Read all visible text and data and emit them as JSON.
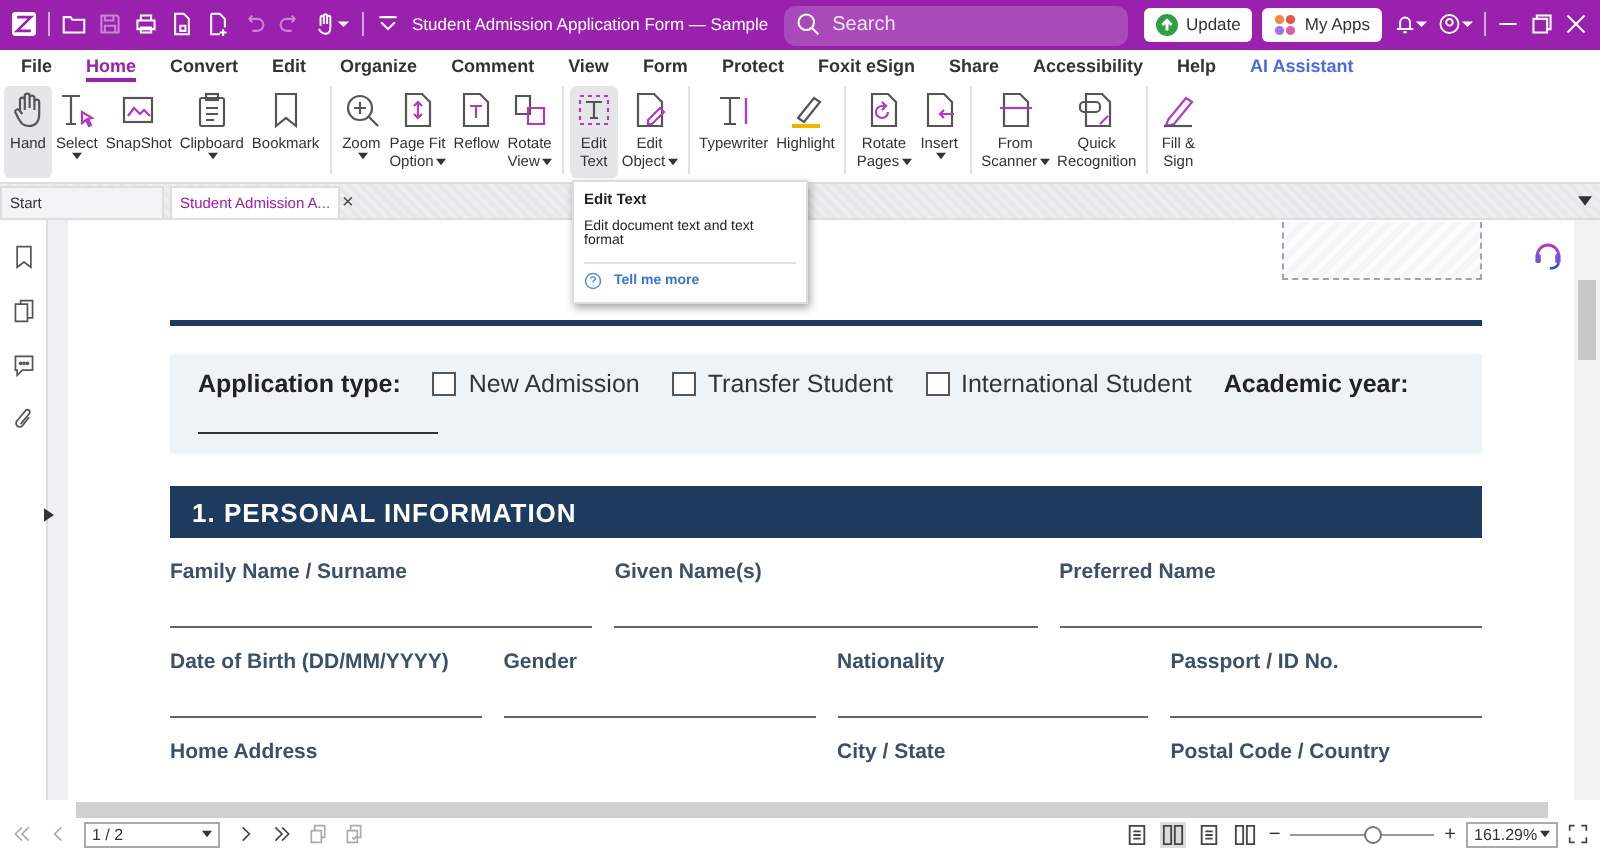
{
  "window": {
    "title": "Student Admission Application Form — Sample",
    "search": {
      "placeholder": "Search"
    },
    "buttons": [
      {
        "label": "Update",
        "kind": "update"
      },
      {
        "label": "My Apps",
        "kind": "apps"
      }
    ]
  },
  "menu": [
    {
      "label": "File",
      "selected": false
    },
    {
      "label": "Home",
      "selected": true
    },
    {
      "label": "Convert",
      "selected": false
    },
    {
      "label": "Edit",
      "selected": false
    },
    {
      "label": "Organize",
      "selected": false
    },
    {
      "label": "Comment",
      "selected": false
    },
    {
      "label": "View",
      "selected": false
    },
    {
      "label": "Form",
      "selected": false
    },
    {
      "label": "Protect",
      "selected": false
    },
    {
      "label": "Foxit eSign",
      "selected": false
    },
    {
      "label": "Share",
      "selected": false
    },
    {
      "label": "Accessibility",
      "selected": false
    },
    {
      "label": "Help",
      "selected": false
    },
    {
      "label": "AI Assistant",
      "selected": false,
      "kind": "ai"
    }
  ],
  "ribbon": [
    [
      {
        "lines": [
          "Hand"
        ],
        "dropdown": false,
        "selected": true
      },
      {
        "lines": [
          "Select"
        ],
        "dropdown": true,
        "selected": false
      },
      {
        "lines": [
          "SnapShot"
        ],
        "dropdown": false,
        "selected": false
      },
      {
        "lines": [
          "Clipboard"
        ],
        "dropdown": true,
        "selected": false
      },
      {
        "lines": [
          "Bookmark"
        ],
        "dropdown": false,
        "selected": false
      }
    ],
    [
      {
        "lines": [
          "Zoom"
        ],
        "dropdown": true,
        "selected": false
      },
      {
        "lines": [
          "Page Fit",
          "Option"
        ],
        "dropdown": true,
        "selected": false
      },
      {
        "lines": [
          "Reflow"
        ],
        "dropdown": false,
        "selected": false
      },
      {
        "lines": [
          "Rotate",
          "View"
        ],
        "dropdown": true,
        "selected": false
      }
    ],
    [
      {
        "lines": [
          "Edit",
          "Text"
        ],
        "dropdown": false,
        "selected": true
      },
      {
        "lines": [
          "Edit",
          "Object"
        ],
        "dropdown": true,
        "selected": false
      }
    ],
    [
      {
        "lines": [
          "Typewriter"
        ],
        "dropdown": false,
        "selected": false
      },
      {
        "lines": [
          "Highlight"
        ],
        "dropdown": false,
        "selected": false
      }
    ],
    [
      {
        "lines": [
          "Rotate",
          "Pages"
        ],
        "dropdown": true,
        "selected": false
      },
      {
        "lines": [
          "Insert"
        ],
        "dropdown": true,
        "selected": false
      }
    ],
    [
      {
        "lines": [
          "From",
          "Scanner"
        ],
        "dropdown": true,
        "selected": false
      },
      {
        "lines": [
          "Quick",
          "Recognition"
        ],
        "dropdown": false,
        "selected": false
      }
    ],
    [
      {
        "lines": [
          "Fill &",
          "Sign"
        ],
        "dropdown": false,
        "selected": false
      }
    ]
  ],
  "tabs": [
    {
      "label": "Start",
      "selected": false
    },
    {
      "label": "Student Admission A...",
      "selected": true,
      "close": "×"
    }
  ],
  "tooltip": {
    "title": "Edit Text",
    "description": "Edit document text and text format",
    "link": "Tell me more"
  },
  "document": {
    "application_type": {
      "label": "Application type:",
      "options": [
        {
          "label": "New Admission",
          "checked": false
        },
        {
          "label": "Transfer Student",
          "checked": false
        },
        {
          "label": "International Student",
          "checked": false
        }
      ],
      "academic_year": "Academic year:"
    },
    "section": "1. PERSONAL INFORMATION",
    "rows": [
      [
        {
          "label": "Family Name / Surname"
        },
        {
          "label": "Given Name(s)"
        },
        {
          "label": "Preferred Name"
        }
      ],
      [
        {
          "label": "Date of Birth (DD/MM/YYYY)"
        },
        {
          "label": "Gender"
        },
        {
          "label": "Nationality"
        },
        {
          "label": "Passport / ID No."
        }
      ],
      [
        {
          "label": "Home Address",
          "wide": true
        },
        {
          "label": "City / State"
        },
        {
          "label": "Postal Code / Country"
        }
      ]
    ]
  },
  "status_bar": {
    "page": "1 / 2",
    "view_modes": [
      {
        "selected": false
      },
      {
        "selected": true
      },
      {
        "selected": false
      },
      {
        "selected": false
      }
    ],
    "zoom": {
      "level": 0.58,
      "value": "161.29%",
      "minus": "−",
      "plus": "+"
    }
  }
}
